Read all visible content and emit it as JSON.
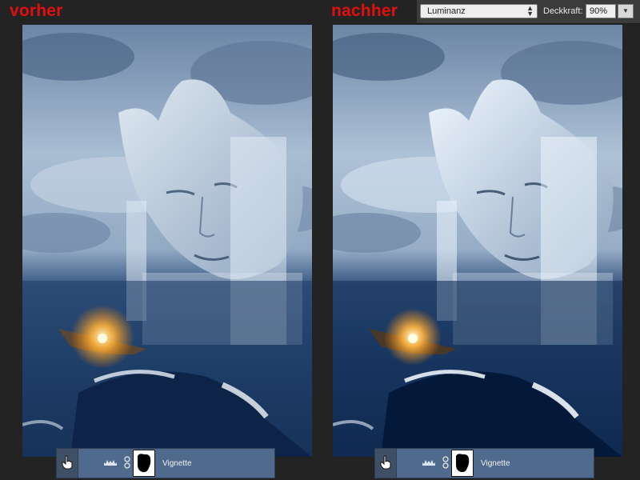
{
  "labels": {
    "before": "vorher",
    "after": "nachher"
  },
  "toolbar": {
    "blend_mode": "Luminanz",
    "opacity_label": "Deckkraft:",
    "opacity_value": "90%"
  },
  "layers": {
    "left": {
      "name": "Vignette"
    },
    "right": {
      "name": "Vignette"
    }
  },
  "colors": {
    "label_red": "#e01010",
    "layer_selected": "#4f6a8c"
  },
  "icons": [
    "pointing-hand-icon",
    "levels-adjustment-icon",
    "chain-link-icon",
    "mask-thumbnail-icon",
    "updown-arrows-icon",
    "chevron-down-icon"
  ]
}
